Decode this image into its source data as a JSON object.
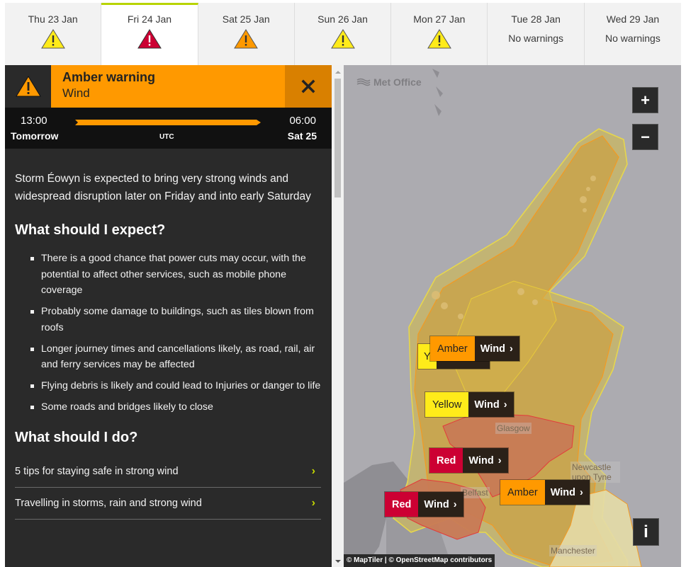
{
  "colors": {
    "yellow": "#ffeb1a",
    "amber": "#ff9900",
    "red": "#cc0033",
    "active_tab_accent": "#b8d400",
    "link_chevron": "#c5d900"
  },
  "days": [
    {
      "label": "Thu 23 Jan",
      "warning": "yellow",
      "icon": "warning-triangle-icon"
    },
    {
      "label": "Fri 24 Jan",
      "warning": "red",
      "icon": "warning-triangle-icon",
      "active": true
    },
    {
      "label": "Sat 25 Jan",
      "warning": "amber",
      "icon": "warning-triangle-icon"
    },
    {
      "label": "Sun 26 Jan",
      "warning": "yellow",
      "icon": "warning-triangle-icon"
    },
    {
      "label": "Mon 27 Jan",
      "warning": "yellow",
      "icon": "warning-triangle-icon"
    },
    {
      "label": "Tue 28 Jan",
      "warning": null,
      "text": "No warnings"
    },
    {
      "label": "Wed 29 Jan",
      "warning": null,
      "text": "No warnings"
    }
  ],
  "warning": {
    "level": "Amber warning",
    "type": "Wind",
    "close_icon": "close-icon",
    "start_time": "13:00",
    "start_day": "Tomorrow",
    "timezone": "UTC",
    "end_time": "06:00",
    "end_day": "Sat 25",
    "summary": "Storm Éowyn is expected to bring very strong winds and widespread disruption later on Friday and into early Saturday",
    "expect_heading": "What should I expect?",
    "expect_items": [
      "There is a good chance that power cuts may occur, with the potential to affect other services, such as mobile phone coverage",
      "Probably some damage to buildings, such as tiles blown from roofs",
      "Longer journey times and cancellations likely, as road, rail, air and ferry services may be affected",
      "Flying debris is likely and could lead to Injuries or danger to life",
      "Some roads and bridges likely to close"
    ],
    "do_heading": "What should I do?",
    "links": [
      {
        "label": "5 tips for staying safe in strong wind",
        "icon": "chevron-right-icon"
      },
      {
        "label": "Travelling in storms, rain and strong wind",
        "icon": "chevron-right-icon"
      }
    ]
  },
  "map": {
    "logo_text": "Met Office",
    "zoom_in": "+",
    "zoom_out": "−",
    "info": "i",
    "attribution": "© MapTiler | © OpenStreetMap contributors",
    "cities": [
      "Glasgow",
      "Newcastle upon Tyne",
      "Belfast",
      "Manchester"
    ],
    "markers": [
      {
        "level": "Yellow",
        "type": "Wind",
        "color": "yellow",
        "partial_label": "Y"
      },
      {
        "level": "Amber",
        "type": "Wind",
        "color": "amber"
      },
      {
        "level": "Yellow",
        "type": "Wind",
        "color": "yellow"
      },
      {
        "level": "Red",
        "type": "Wind",
        "color": "red"
      },
      {
        "level": "Red",
        "type": "Wind",
        "color": "red"
      },
      {
        "level": "Amber",
        "type": "Wind",
        "color": "amber"
      }
    ],
    "marker_chevron": "›"
  }
}
